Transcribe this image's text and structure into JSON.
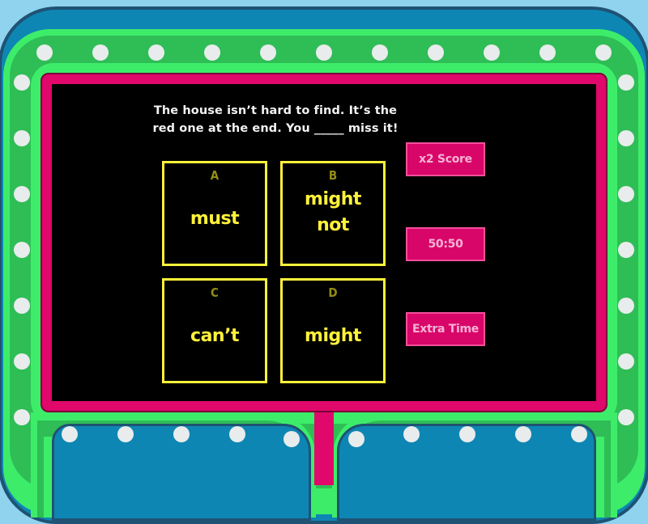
{
  "question": {
    "line1": "The house isn’t hard to find. It’s the",
    "line2": "red one at the end. You _____ miss it!"
  },
  "answers": [
    {
      "letter": "A",
      "text": "must"
    },
    {
      "letter": "B",
      "text": "might not"
    },
    {
      "letter": "C",
      "text": "can’t"
    },
    {
      "letter": "D",
      "text": "might"
    }
  ],
  "powerups": {
    "double_score": "x2 Score",
    "fifty_fifty": "50:50",
    "extra_time": "Extra Time"
  },
  "colors": {
    "frame_blue": "#0e86b3",
    "frame_green": "#3ded6a",
    "frame_green_dark": "#2fbd55",
    "screen_pink": "#e0086a",
    "answer_yellow": "#fff23a",
    "letter_olive": "#948d12",
    "powerup_pink": "#d9066a",
    "dot_white": "#e8ecec"
  }
}
